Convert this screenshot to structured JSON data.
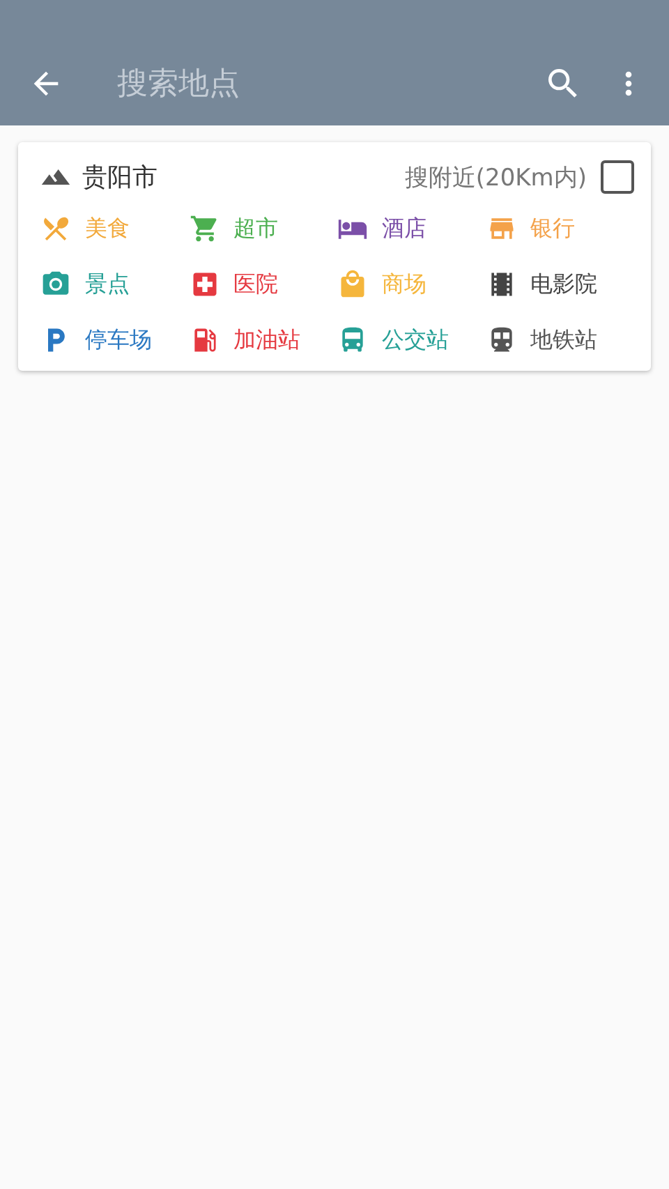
{
  "toolbar": {
    "placeholder": "搜索地点"
  },
  "city": {
    "name": "贵阳市",
    "nearby_label": "搜附近(20Km内)",
    "nearby_checked": false
  },
  "categories": [
    {
      "label": "美食",
      "kind": "food",
      "color": "#f2a93b"
    },
    {
      "label": "超市",
      "kind": "cart",
      "color": "#4caf50"
    },
    {
      "label": "酒店",
      "kind": "hotel",
      "color": "#7b4fa8"
    },
    {
      "label": "银行",
      "kind": "bank",
      "color": "#f4a24a"
    },
    {
      "label": "景点",
      "kind": "camera",
      "color": "#26a096"
    },
    {
      "label": "医院",
      "kind": "hospital",
      "color": "#e53940"
    },
    {
      "label": "商场",
      "kind": "mall",
      "color": "#f5b63c"
    },
    {
      "label": "电影院",
      "kind": "movie",
      "color": "#444444"
    },
    {
      "label": "停车场",
      "kind": "parking",
      "color": "#2a78c2"
    },
    {
      "label": "加油站",
      "kind": "gas",
      "color": "#e53940"
    },
    {
      "label": "公交站",
      "kind": "bus",
      "color": "#26a096"
    },
    {
      "label": "地铁站",
      "kind": "subway",
      "color": "#555555"
    }
  ]
}
